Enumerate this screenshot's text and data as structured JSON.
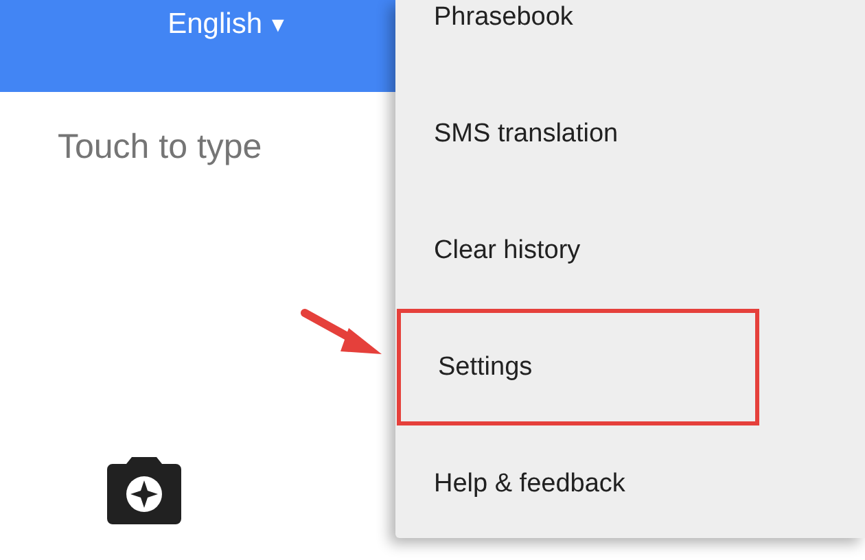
{
  "header": {
    "language": "English",
    "caret": "▼"
  },
  "input": {
    "placeholder": "Touch to type"
  },
  "menu": {
    "items": [
      {
        "label": "Phrasebook",
        "highlighted": false
      },
      {
        "label": "SMS translation",
        "highlighted": false
      },
      {
        "label": "Clear history",
        "highlighted": false
      },
      {
        "label": "Settings",
        "highlighted": true
      },
      {
        "label": "Help & feedback",
        "highlighted": false
      }
    ]
  }
}
